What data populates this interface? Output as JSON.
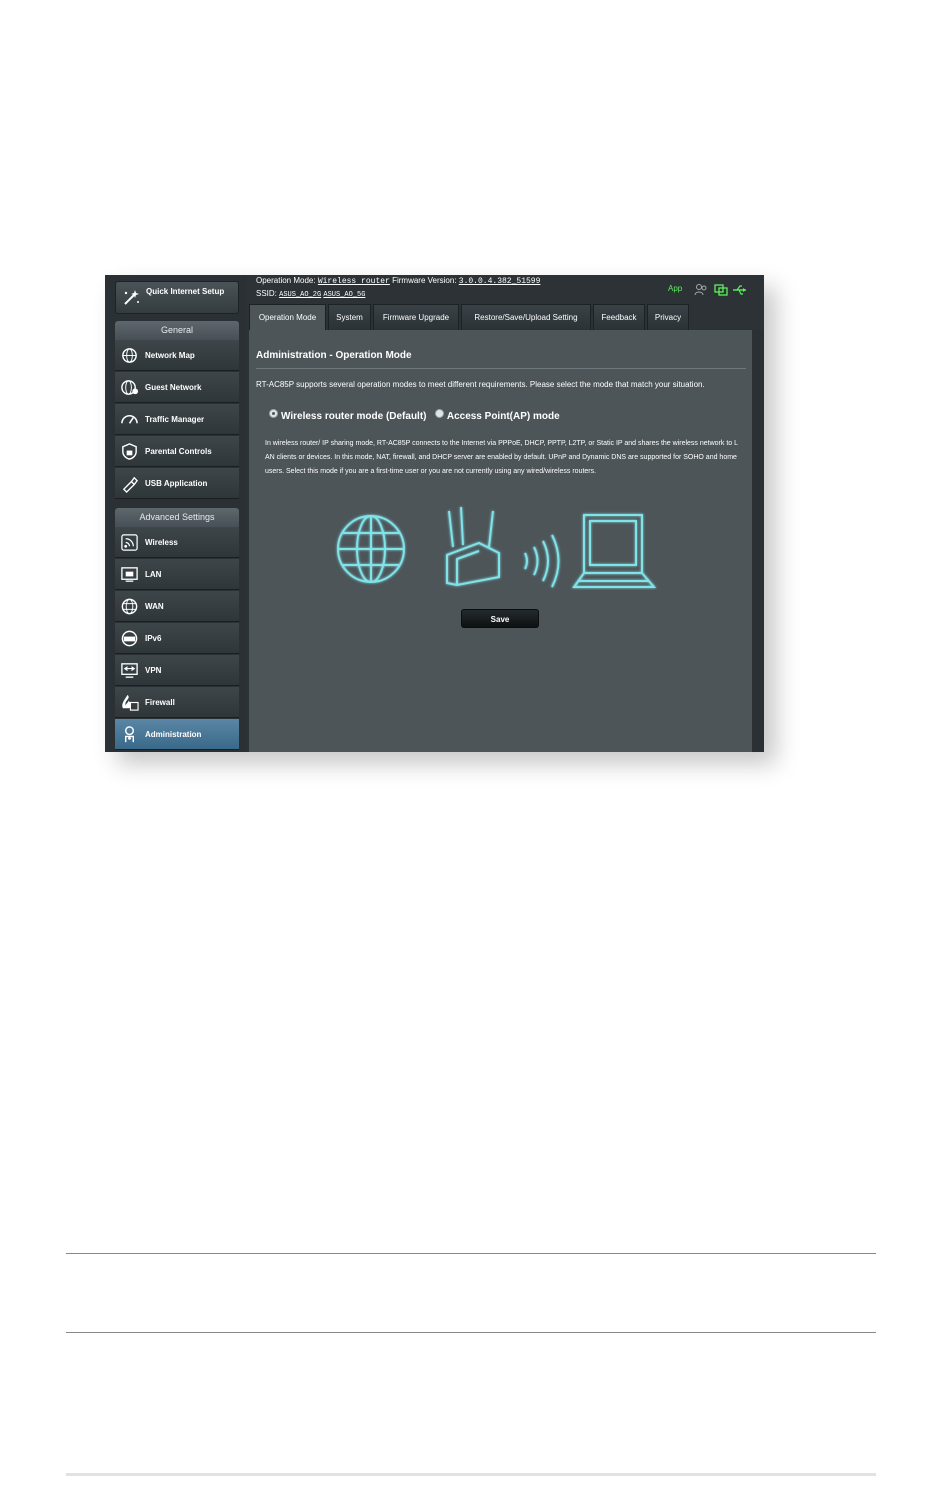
{
  "header": {
    "op_mode_label": "Operation Mode:",
    "op_mode_value": "Wireless router",
    "fw_label": "Firmware Version:",
    "fw_value": "3.0.0.4.382_51599",
    "ssid_label": "SSID:",
    "ssid_2g": "ASUS_AO_2G",
    "ssid_5g": "ASUS_AO_5G",
    "app_label": "App"
  },
  "sidebar": {
    "qis_label": "Quick Internet Setup",
    "general_header": "General",
    "general_items": [
      {
        "label": "Network Map",
        "icon": "network-map-icon"
      },
      {
        "label": "Guest Network",
        "icon": "guest-network-icon"
      },
      {
        "label": "Traffic Manager",
        "icon": "traffic-manager-icon"
      },
      {
        "label": "Parental Controls",
        "icon": "parental-controls-icon"
      },
      {
        "label": "USB Application",
        "icon": "usb-application-icon"
      }
    ],
    "advanced_header": "Advanced Settings",
    "advanced_items": [
      {
        "label": "Wireless",
        "icon": "wireless-icon"
      },
      {
        "label": "LAN",
        "icon": "lan-icon"
      },
      {
        "label": "WAN",
        "icon": "wan-icon"
      },
      {
        "label": "IPv6",
        "icon": "ipv6-icon"
      },
      {
        "label": "VPN",
        "icon": "vpn-icon"
      },
      {
        "label": "Firewall",
        "icon": "firewall-icon"
      },
      {
        "label": "Administration",
        "icon": "administration-icon",
        "active": true
      }
    ]
  },
  "tabs": [
    {
      "label": "Operation Mode",
      "active": true
    },
    {
      "label": "System"
    },
    {
      "label": "Firmware Upgrade"
    },
    {
      "label": "Restore/Save/Upload Setting"
    },
    {
      "label": "Feedback"
    },
    {
      "label": "Privacy"
    }
  ],
  "content": {
    "title": "Administration - Operation Mode",
    "intro": "RT-AC85P supports several operation modes to meet different requirements. Please select the mode that match your situation.",
    "mode_router": "Wireless router mode (Default)",
    "mode_ap": "Access Point(AP) mode",
    "description": "In wireless router/ IP sharing mode, RT-AC85P connects to the Internet via PPPoE, DHCP, PPTP, L2TP, or Static IP and shares the wireless network to LAN clients or devices. In this mode, NAT, firewall, and DHCP server are enabled by default. UPnP and Dynamic DNS are supported for SOHO and home users. Select this mode if you are a first-time user or you are not currently using any wired/wireless routers.",
    "save_label": "Save"
  },
  "colors": {
    "accent_green": "#5df05d",
    "illustration_cyan": "#7fe3e8",
    "active_menu": "#4a7a9a"
  }
}
